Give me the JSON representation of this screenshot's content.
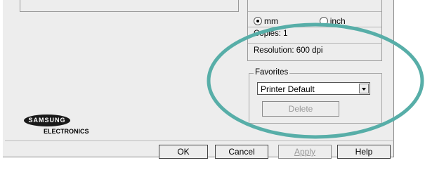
{
  "units": {
    "option_mm": "mm",
    "option_inch": "inch",
    "selected": "mm"
  },
  "info": {
    "partial_line": "Copies: 1",
    "resolution": "Resolution: 600 dpi"
  },
  "favorites": {
    "legend": "Favorites",
    "selected": "Printer Default",
    "delete_label": "Delete"
  },
  "logo": {
    "brand": "SAMSUNG",
    "sub": "ELECTRONICS"
  },
  "footer": {
    "ok": "OK",
    "cancel": "Cancel",
    "apply": "Apply",
    "help": "Help"
  },
  "colors": {
    "highlight_ellipse": "#57aea8"
  }
}
